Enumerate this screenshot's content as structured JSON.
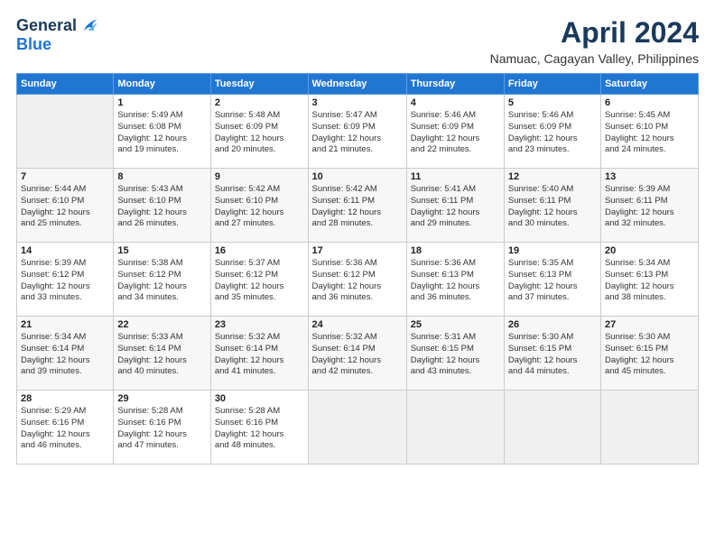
{
  "logo": {
    "line1": "General",
    "line2": "Blue"
  },
  "title": "April 2024",
  "subtitle": "Namuac, Cagayan Valley, Philippines",
  "days_header": [
    "Sunday",
    "Monday",
    "Tuesday",
    "Wednesday",
    "Thursday",
    "Friday",
    "Saturday"
  ],
  "weeks": [
    [
      {
        "num": "",
        "info": ""
      },
      {
        "num": "1",
        "info": "Sunrise: 5:49 AM\nSunset: 6:08 PM\nDaylight: 12 hours\nand 19 minutes."
      },
      {
        "num": "2",
        "info": "Sunrise: 5:48 AM\nSunset: 6:09 PM\nDaylight: 12 hours\nand 20 minutes."
      },
      {
        "num": "3",
        "info": "Sunrise: 5:47 AM\nSunset: 6:09 PM\nDaylight: 12 hours\nand 21 minutes."
      },
      {
        "num": "4",
        "info": "Sunrise: 5:46 AM\nSunset: 6:09 PM\nDaylight: 12 hours\nand 22 minutes."
      },
      {
        "num": "5",
        "info": "Sunrise: 5:46 AM\nSunset: 6:09 PM\nDaylight: 12 hours\nand 23 minutes."
      },
      {
        "num": "6",
        "info": "Sunrise: 5:45 AM\nSunset: 6:10 PM\nDaylight: 12 hours\nand 24 minutes."
      }
    ],
    [
      {
        "num": "7",
        "info": "Sunrise: 5:44 AM\nSunset: 6:10 PM\nDaylight: 12 hours\nand 25 minutes."
      },
      {
        "num": "8",
        "info": "Sunrise: 5:43 AM\nSunset: 6:10 PM\nDaylight: 12 hours\nand 26 minutes."
      },
      {
        "num": "9",
        "info": "Sunrise: 5:42 AM\nSunset: 6:10 PM\nDaylight: 12 hours\nand 27 minutes."
      },
      {
        "num": "10",
        "info": "Sunrise: 5:42 AM\nSunset: 6:11 PM\nDaylight: 12 hours\nand 28 minutes."
      },
      {
        "num": "11",
        "info": "Sunrise: 5:41 AM\nSunset: 6:11 PM\nDaylight: 12 hours\nand 29 minutes."
      },
      {
        "num": "12",
        "info": "Sunrise: 5:40 AM\nSunset: 6:11 PM\nDaylight: 12 hours\nand 30 minutes."
      },
      {
        "num": "13",
        "info": "Sunrise: 5:39 AM\nSunset: 6:11 PM\nDaylight: 12 hours\nand 32 minutes."
      }
    ],
    [
      {
        "num": "14",
        "info": "Sunrise: 5:39 AM\nSunset: 6:12 PM\nDaylight: 12 hours\nand 33 minutes."
      },
      {
        "num": "15",
        "info": "Sunrise: 5:38 AM\nSunset: 6:12 PM\nDaylight: 12 hours\nand 34 minutes."
      },
      {
        "num": "16",
        "info": "Sunrise: 5:37 AM\nSunset: 6:12 PM\nDaylight: 12 hours\nand 35 minutes."
      },
      {
        "num": "17",
        "info": "Sunrise: 5:36 AM\nSunset: 6:12 PM\nDaylight: 12 hours\nand 36 minutes."
      },
      {
        "num": "18",
        "info": "Sunrise: 5:36 AM\nSunset: 6:13 PM\nDaylight: 12 hours\nand 36 minutes."
      },
      {
        "num": "19",
        "info": "Sunrise: 5:35 AM\nSunset: 6:13 PM\nDaylight: 12 hours\nand 37 minutes."
      },
      {
        "num": "20",
        "info": "Sunrise: 5:34 AM\nSunset: 6:13 PM\nDaylight: 12 hours\nand 38 minutes."
      }
    ],
    [
      {
        "num": "21",
        "info": "Sunrise: 5:34 AM\nSunset: 6:14 PM\nDaylight: 12 hours\nand 39 minutes."
      },
      {
        "num": "22",
        "info": "Sunrise: 5:33 AM\nSunset: 6:14 PM\nDaylight: 12 hours\nand 40 minutes."
      },
      {
        "num": "23",
        "info": "Sunrise: 5:32 AM\nSunset: 6:14 PM\nDaylight: 12 hours\nand 41 minutes."
      },
      {
        "num": "24",
        "info": "Sunrise: 5:32 AM\nSunset: 6:14 PM\nDaylight: 12 hours\nand 42 minutes."
      },
      {
        "num": "25",
        "info": "Sunrise: 5:31 AM\nSunset: 6:15 PM\nDaylight: 12 hours\nand 43 minutes."
      },
      {
        "num": "26",
        "info": "Sunrise: 5:30 AM\nSunset: 6:15 PM\nDaylight: 12 hours\nand 44 minutes."
      },
      {
        "num": "27",
        "info": "Sunrise: 5:30 AM\nSunset: 6:15 PM\nDaylight: 12 hours\nand 45 minutes."
      }
    ],
    [
      {
        "num": "28",
        "info": "Sunrise: 5:29 AM\nSunset: 6:16 PM\nDaylight: 12 hours\nand 46 minutes."
      },
      {
        "num": "29",
        "info": "Sunrise: 5:28 AM\nSunset: 6:16 PM\nDaylight: 12 hours\nand 47 minutes."
      },
      {
        "num": "30",
        "info": "Sunrise: 5:28 AM\nSunset: 6:16 PM\nDaylight: 12 hours\nand 48 minutes."
      },
      {
        "num": "",
        "info": ""
      },
      {
        "num": "",
        "info": ""
      },
      {
        "num": "",
        "info": ""
      },
      {
        "num": "",
        "info": ""
      }
    ]
  ]
}
